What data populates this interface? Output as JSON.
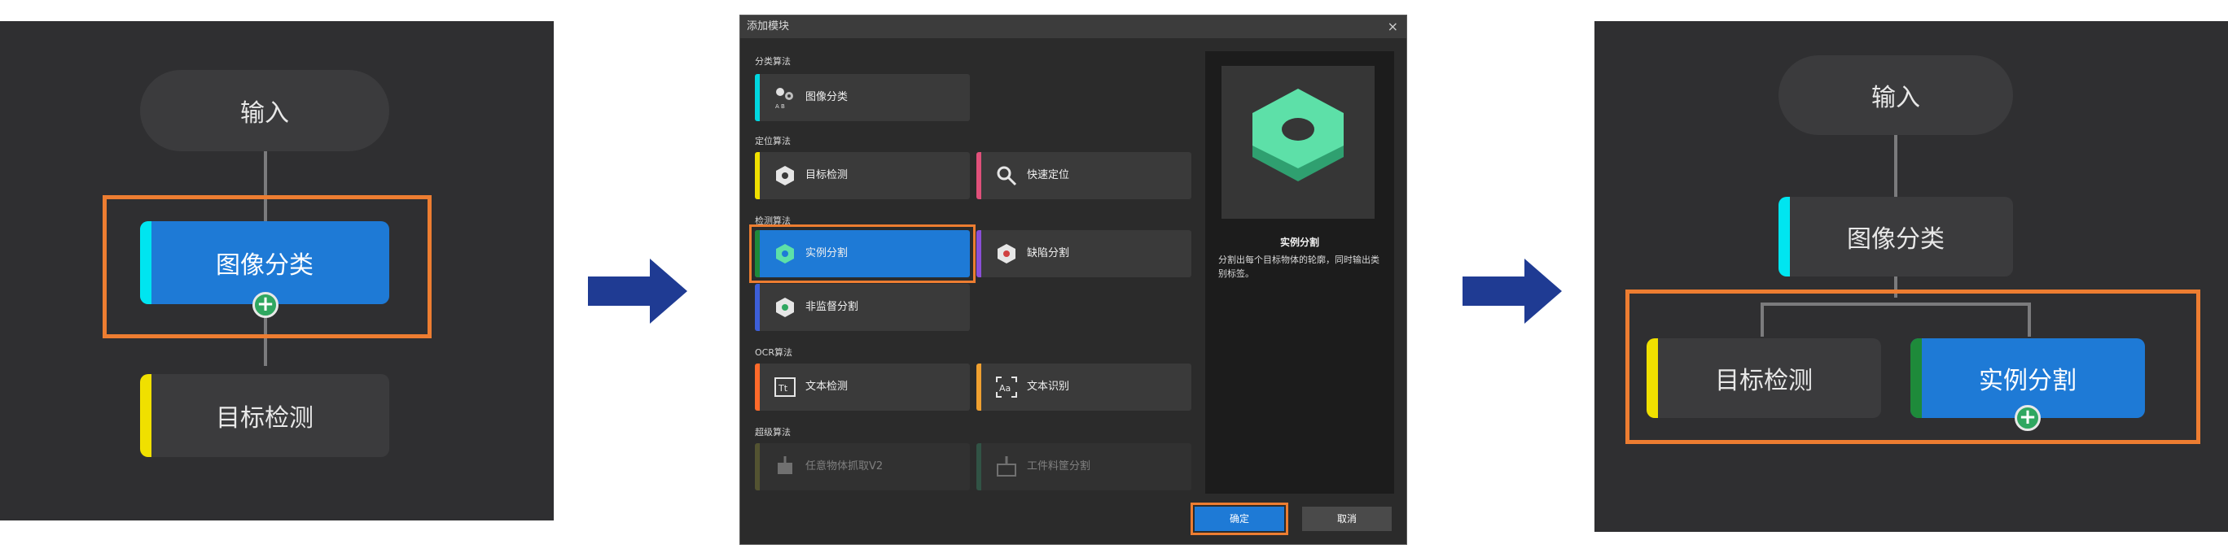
{
  "step1": {
    "nodes": {
      "input": "输入",
      "image_classification": "图像分类",
      "object_detection": "目标检测"
    }
  },
  "dialog": {
    "title": "添加模块",
    "close_glyph": "×",
    "categories": {
      "classification": "分类算法",
      "localization": "定位算法",
      "detection": "检测算法",
      "ocr": "OCR算法",
      "super": "超级算法"
    },
    "modules": {
      "image_classification": "图像分类",
      "object_detection": "目标检测",
      "fast_positioning": "快速定位",
      "instance_segmentation": "实例分割",
      "defect_segmentation": "缺陷分割",
      "unsupervised_segmentation": "非监督分割",
      "text_detection": "文本检测",
      "text_recognition": "文本识别",
      "any_object_grasp": "任意物体抓取V2",
      "workpiece_segmentation": "工件料筐分割"
    },
    "preview": {
      "title": "实例分割",
      "description": "分割出每个目标物体的轮廓，同时输出类别标签。"
    },
    "buttons": {
      "ok": "确定",
      "cancel": "取消"
    }
  },
  "step3": {
    "nodes": {
      "input": "输入",
      "image_classification": "图像分类",
      "object_detection": "目标检测",
      "instance_segmentation": "实例分割"
    }
  },
  "colors": {
    "highlight": "#ed7d31",
    "arrow": "#1f3b93",
    "panel_bg": "#2f2f31",
    "node_bg": "#3b3b3d",
    "selected_blue": "#1e7ad6",
    "cyan": "#00e5f0",
    "yellow": "#f0e000",
    "green": "#1e8a3a",
    "add_green": "#2fa760"
  }
}
